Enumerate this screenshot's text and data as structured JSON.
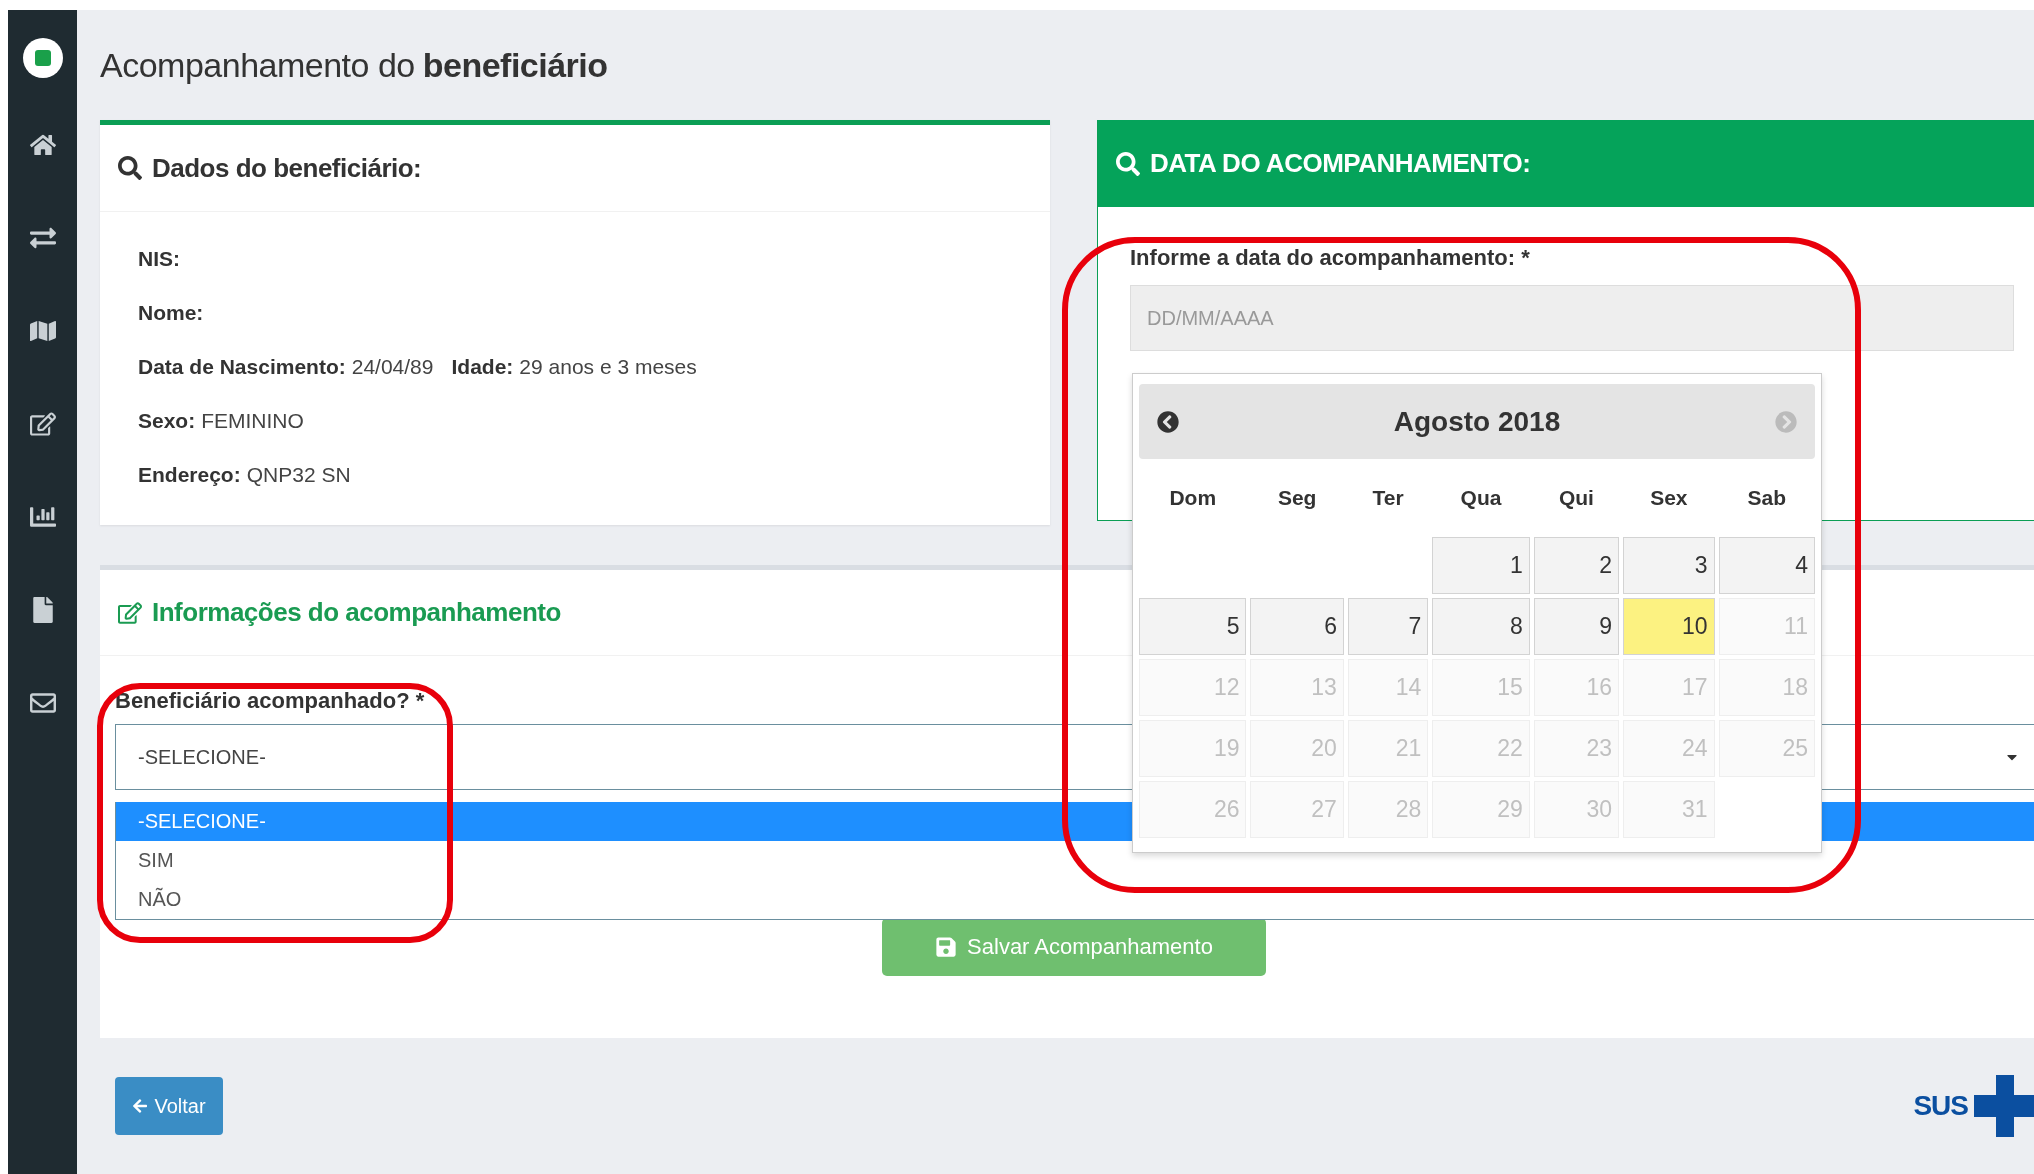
{
  "page": {
    "title_plain": "Acompanhamento do ",
    "title_bold": "beneficiário"
  },
  "sidebar": {
    "items": [
      {
        "kind": "home",
        "selected": false
      },
      {
        "kind": "exchange",
        "selected": false
      },
      {
        "kind": "map",
        "selected": false
      },
      {
        "kind": "edit",
        "selected": false
      },
      {
        "kind": "chart",
        "selected": false
      },
      {
        "kind": "file",
        "selected": false
      },
      {
        "kind": "mail",
        "selected": false
      }
    ]
  },
  "beneficiary_card": {
    "title": "Dados do beneficiário:",
    "rows": [
      {
        "items": [
          {
            "label": "NIS:"
          }
        ]
      },
      {
        "items": [
          {
            "label": "Nome:"
          }
        ]
      },
      {
        "items": [
          {
            "label": "Data de Nascimento:",
            "value": "24/04/89"
          },
          {
            "label": "Idade:",
            "value": "29 anos e 3 meses"
          }
        ]
      },
      {
        "items": [
          {
            "label": "Sexo:",
            "value": "FEMININO"
          }
        ]
      },
      {
        "items": [
          {
            "label": "Endereço:",
            "value": "QNP32 SN"
          }
        ]
      }
    ]
  },
  "date_card": {
    "title": "DATA DO ACOMPANHAMENTO:",
    "label": "Informe a data do acompanhamento: *",
    "placeholder": "DD/MM/AAAA"
  },
  "datepicker": {
    "month": "Agosto 2018",
    "prev_disabled": false,
    "next_disabled": true,
    "weekdays": [
      "Dom",
      "Seg",
      "Ter",
      "Qua",
      "Qui",
      "Sex",
      "Sab"
    ],
    "weeks": [
      {
        "days": [
          {
            "day": "1",
            "disabled": false,
            "today": false
          },
          {
            "day": "2",
            "disabled": false,
            "today": false
          },
          {
            "day": "3",
            "disabled": false,
            "today": false
          },
          {
            "day": "4",
            "disabled": false,
            "today": false
          }
        ]
      },
      {
        "days": [
          {
            "day": "5",
            "disabled": false,
            "today": false
          },
          {
            "day": "6",
            "disabled": false,
            "today": false
          },
          {
            "day": "7",
            "disabled": false,
            "today": false
          },
          {
            "day": "8",
            "disabled": false,
            "today": false
          },
          {
            "day": "9",
            "disabled": false,
            "today": false
          },
          {
            "day": "10",
            "disabled": false,
            "today": true
          },
          {
            "day": "11",
            "disabled": true,
            "today": false
          }
        ]
      },
      {
        "days": [
          {
            "day": "12",
            "disabled": true,
            "today": false
          },
          {
            "day": "13",
            "disabled": true,
            "today": false
          },
          {
            "day": "14",
            "disabled": true,
            "today": false
          },
          {
            "day": "15",
            "disabled": true,
            "today": false
          },
          {
            "day": "16",
            "disabled": true,
            "today": false
          },
          {
            "day": "17",
            "disabled": true,
            "today": false
          },
          {
            "day": "18",
            "disabled": true,
            "today": false
          }
        ]
      },
      {
        "days": [
          {
            "day": "19",
            "disabled": true,
            "today": false
          },
          {
            "day": "20",
            "disabled": true,
            "today": false
          },
          {
            "day": "21",
            "disabled": true,
            "today": false
          },
          {
            "day": "22",
            "disabled": true,
            "today": false
          },
          {
            "day": "23",
            "disabled": true,
            "today": false
          },
          {
            "day": "24",
            "disabled": true,
            "today": false
          },
          {
            "day": "25",
            "disabled": true,
            "today": false
          }
        ]
      },
      {
        "days": [
          {
            "day": "26",
            "disabled": true,
            "today": false
          },
          {
            "day": "27",
            "disabled": true,
            "today": false
          },
          {
            "day": "28",
            "disabled": true,
            "today": false
          },
          {
            "day": "29",
            "disabled": true,
            "today": false
          },
          {
            "day": "30",
            "disabled": true,
            "today": false
          },
          {
            "day": "31",
            "disabled": true,
            "today": false
          }
        ]
      }
    ]
  },
  "info_card": {
    "title": "Informações do acompanhamento",
    "label": "Beneficiário acompanhado? *",
    "value": "-SELECIONE-",
    "options": [
      {
        "label": "-SELECIONE-",
        "selected": true
      },
      {
        "label": "SIM",
        "selected": false
      },
      {
        "label": "NÃO",
        "selected": false
      }
    ],
    "save_button": "Salvar Acompanhamento"
  },
  "back_button": "Voltar",
  "footer": {
    "logo_text": "SUS"
  }
}
